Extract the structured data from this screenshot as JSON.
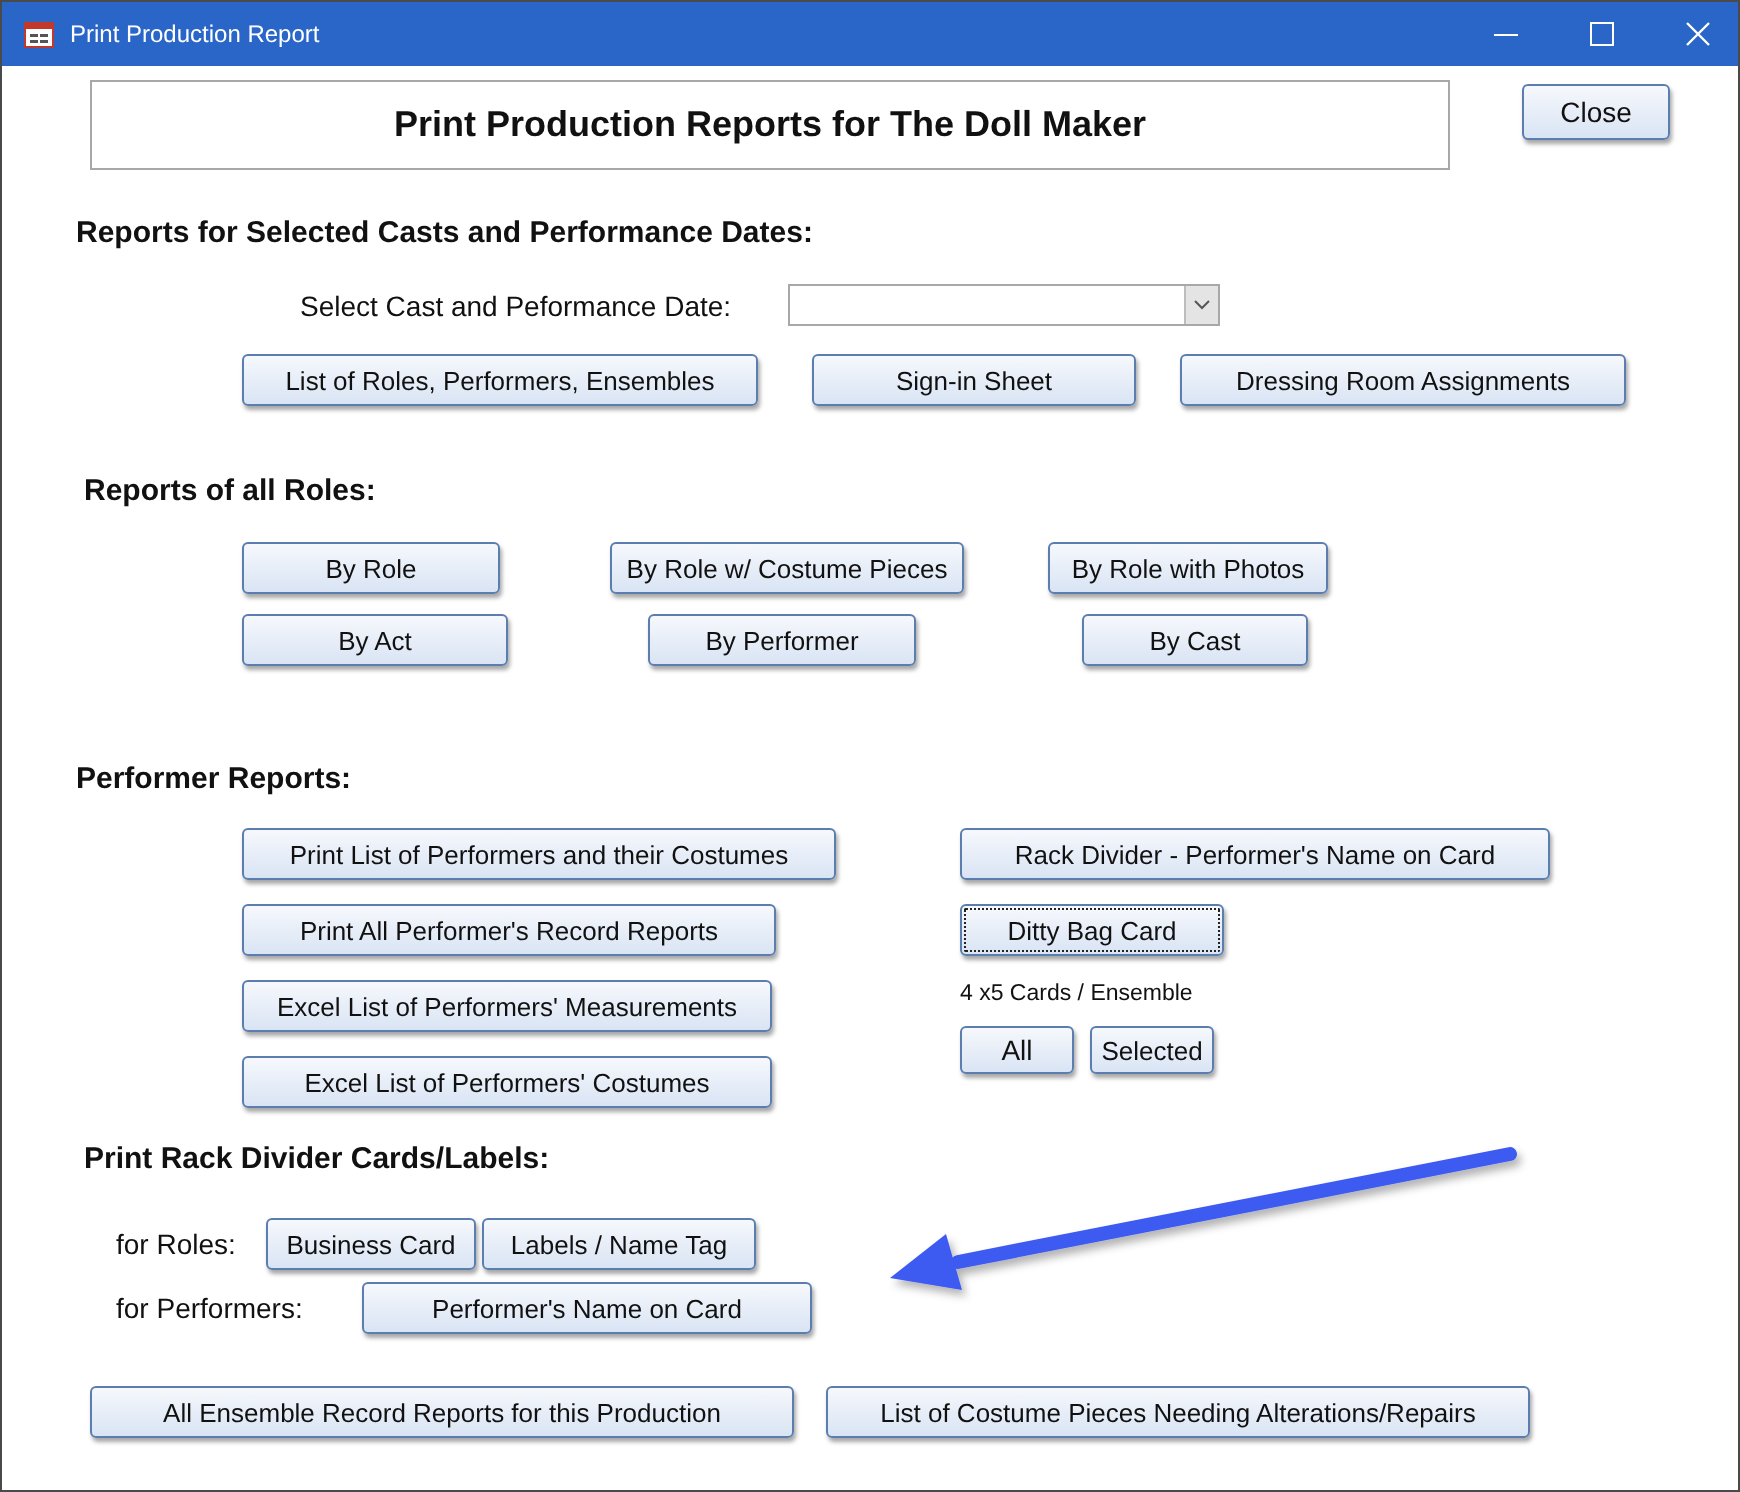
{
  "window": {
    "title": "Print Production Report"
  },
  "header": {
    "title": "Print Production Reports for The Doll Maker"
  },
  "close_button": {
    "label": "Close",
    "focused": false
  },
  "sections": [
    {
      "heading": "Reports for Selected Casts and Performance Dates:",
      "columns": [
        {
          "rows": [
            {
              "items": [
                {
                  "kind": "label",
                  "text": "Select Cast and Peformance Date:"
                },
                {
                  "kind": "select"
                }
              ]
            },
            {
              "items": [
                {
                  "kind": "button",
                  "label": "List of Roles, Performers, Ensembles",
                  "focused": false
                },
                {
                  "kind": "button",
                  "label": "Sign-in Sheet",
                  "focused": false
                },
                {
                  "kind": "button",
                  "label": "Dressing Room Assignments",
                  "focused": false
                }
              ]
            }
          ]
        }
      ]
    },
    {
      "heading": "Reports of all Roles:",
      "columns": [
        {
          "rows": [
            {
              "items": [
                {
                  "kind": "button",
                  "label": "By Role",
                  "focused": false
                },
                {
                  "kind": "button",
                  "label": "By Role w/ Costume Pieces",
                  "focused": false
                },
                {
                  "kind": "button",
                  "label": "By Role with Photos",
                  "focused": false
                }
              ]
            },
            {
              "items": [
                {
                  "kind": "button",
                  "label": "By Act",
                  "focused": false
                },
                {
                  "kind": "button",
                  "label": "By Performer",
                  "focused": false
                },
                {
                  "kind": "button",
                  "label": "By Cast",
                  "focused": false
                }
              ]
            }
          ]
        }
      ]
    },
    {
      "heading": "Performer Reports:",
      "columns": [
        {
          "rows": [
            {
              "items": [
                {
                  "kind": "button",
                  "label": "Print List of Performers and their Costumes",
                  "focused": false
                }
              ]
            },
            {
              "items": [
                {
                  "kind": "button",
                  "label": "Print All Performer's Record Reports",
                  "focused": false
                }
              ]
            },
            {
              "items": [
                {
                  "kind": "button",
                  "label": "Excel List of Performers' Measurements",
                  "focused": false
                }
              ]
            },
            {
              "items": [
                {
                  "kind": "button",
                  "label": "Excel List of Performers' Costumes",
                  "focused": false
                }
              ]
            }
          ]
        },
        {
          "rows": [
            {
              "items": [
                {
                  "kind": "button",
                  "label": "Rack Divider - Performer's Name on Card",
                  "focused": false
                }
              ]
            },
            {
              "items": [
                {
                  "kind": "button",
                  "label": "Ditty Bag Card",
                  "focused": true
                }
              ]
            },
            {
              "items": [
                {
                  "kind": "note",
                  "text": "4 x5 Cards / Ensemble"
                }
              ]
            },
            {
              "items": [
                {
                  "kind": "button",
                  "label": "All",
                  "focused": false
                },
                {
                  "kind": "button",
                  "label": "Selected",
                  "focused": false
                }
              ]
            }
          ]
        }
      ]
    },
    {
      "heading": "Print Rack Divider Cards/Labels:",
      "columns": [
        {
          "rows": [
            {
              "items": [
                {
                  "kind": "label",
                  "text": "for Roles:"
                },
                {
                  "kind": "button",
                  "label": "Business Card",
                  "focused": false
                },
                {
                  "kind": "button",
                  "label": "Labels / Name Tag",
                  "focused": false
                }
              ]
            },
            {
              "items": [
                {
                  "kind": "label",
                  "text": "for Performers:"
                },
                {
                  "kind": "button",
                  "label": "Performer's Name on Card",
                  "focused": false
                }
              ]
            }
          ]
        }
      ]
    },
    {
      "columns": [
        {
          "rows": [
            {
              "items": [
                {
                  "kind": "button",
                  "label": "All Ensemble Record Reports for this Production",
                  "focused": false
                },
                {
                  "kind": "button",
                  "label": "List of Costume Pieces Needing Alterations/Repairs",
                  "focused": false
                }
              ]
            }
          ]
        }
      ]
    }
  ]
}
